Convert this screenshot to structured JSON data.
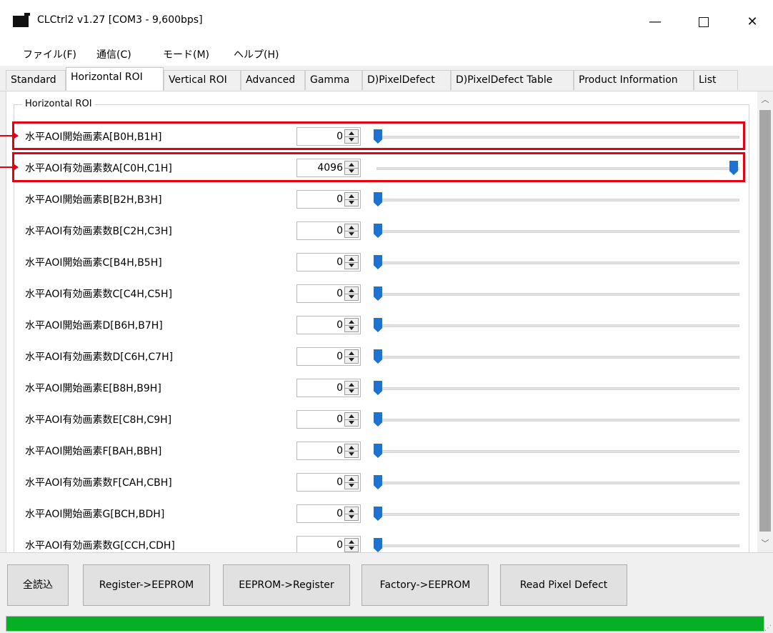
{
  "window": {
    "title": "CLCtrl2 v1.27  [COM3 - 9,600bps]",
    "min_glyph": "—",
    "close_glyph": "✕"
  },
  "menu": [
    {
      "label": "ファイル(F)"
    },
    {
      "label": "通信(C)"
    },
    {
      "label": "モード(M)"
    },
    {
      "label": "ヘルプ(H)"
    }
  ],
  "tabs": [
    {
      "label": "Standard"
    },
    {
      "label": "Horizontal ROI",
      "active": true
    },
    {
      "label": "Vertical ROI"
    },
    {
      "label": "Advanced"
    },
    {
      "label": "Gamma"
    },
    {
      "label": "D)PixelDefect"
    },
    {
      "label": "D)PixelDefect Table"
    },
    {
      "label": "Product Information"
    },
    {
      "label": "List"
    }
  ],
  "group_title": "Horizontal ROI",
  "rows": [
    {
      "label": "水平AOI開始画素A[B0H,B1H]",
      "value": "0",
      "slider": 0.0
    },
    {
      "label": "水平AOI有効画素数A[C0H,C1H]",
      "value": "4096",
      "slider": 1.0
    },
    {
      "label": "水平AOI開始画素B[B2H,B3H]",
      "value": "0",
      "slider": 0.0
    },
    {
      "label": "水平AOI有効画素数B[C2H,C3H]",
      "value": "0",
      "slider": 0.0
    },
    {
      "label": "水平AOI開始画素C[B4H,B5H]",
      "value": "0",
      "slider": 0.0
    },
    {
      "label": "水平AOI有効画素数C[C4H,C5H]",
      "value": "0",
      "slider": 0.0
    },
    {
      "label": "水平AOI開始画素D[B6H,B7H]",
      "value": "0",
      "slider": 0.0
    },
    {
      "label": "水平AOI有効画素数D[C6H,C7H]",
      "value": "0",
      "slider": 0.0
    },
    {
      "label": "水平AOI開始画素E[B8H,B9H]",
      "value": "0",
      "slider": 0.0
    },
    {
      "label": "水平AOI有効画素数E[C8H,C9H]",
      "value": "0",
      "slider": 0.0
    },
    {
      "label": "水平AOI開始画素F[BAH,BBH]",
      "value": "0",
      "slider": 0.0
    },
    {
      "label": "水平AOI有効画素数F[CAH,CBH]",
      "value": "0",
      "slider": 0.0
    },
    {
      "label": "水平AOI開始画素G[BCH,BDH]",
      "value": "0",
      "slider": 0.0
    },
    {
      "label": "水平AOI有効画素数G[CCH,CDH]",
      "value": "0",
      "slider": 0.0
    }
  ],
  "buttons": [
    {
      "label": "全読込"
    },
    {
      "label": "Register->EEPROM"
    },
    {
      "label": "EEPROM->Register"
    },
    {
      "label": "Factory->EEPROM"
    },
    {
      "label": "Read Pixel Defect"
    }
  ],
  "progress": 1.0,
  "colors": {
    "highlight": "#e60012",
    "slider_thumb": "#1e72d2",
    "progress": "#06b025"
  }
}
